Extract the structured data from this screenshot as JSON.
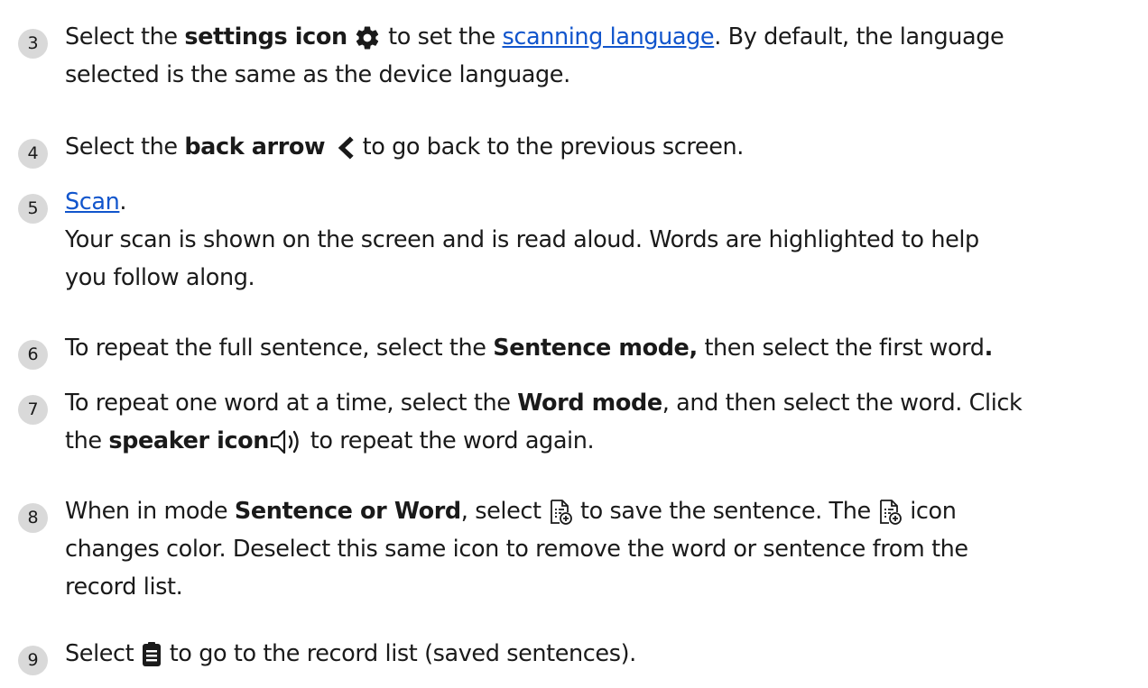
{
  "steps": [
    {
      "number": "3",
      "t1": "Select the ",
      "b1": "settings icon",
      "t2": " to set the ",
      "link": "scanning language",
      "t3": ". By default, the language",
      "line2": "selected is the same as the device language.",
      "icon": "gear-icon"
    },
    {
      "number": "4",
      "t1": "Select the ",
      "b1": "back arrow",
      "t2": " to go back to the previous screen.",
      "icon": "back-arrow-icon"
    },
    {
      "number": "5",
      "link": "Scan",
      "t1": ".",
      "line2": "Your scan is shown on the screen and is read aloud.  Words are highlighted to help",
      "line3": "you follow along."
    },
    {
      "number": "6",
      "t1": "To repeat the full sentence, select the ",
      "b1": "Sentence mode,",
      "t2": " then select the first word",
      "b2": "."
    },
    {
      "number": "7",
      "t1": "To repeat one word at a time, select the ",
      "b1": "Word mode",
      "t2": ", and then select the word. Click",
      "t3": "the ",
      "b2": "speaker icon",
      "t4": " to repeat the word again.",
      "icon": "speaker-icon"
    },
    {
      "number": "8",
      "t1": "When in mode ",
      "b1": "Sentence or Word",
      "t2": ", select ",
      "t3": " to save the sentence. The ",
      "t4": " icon",
      "line2": "changes color.  Deselect this same icon to remove the word or sentence from the",
      "line3": "record list.",
      "icon": "save-sentence-icon"
    },
    {
      "number": "9",
      "t1": "Select ",
      "t2": " to go to the record list (saved sentences).",
      "icon": "record-list-icon"
    }
  ],
  "colors": {
    "link": "#1155cc",
    "badge": "#d9d9d9",
    "text": "#1a1a1a"
  }
}
